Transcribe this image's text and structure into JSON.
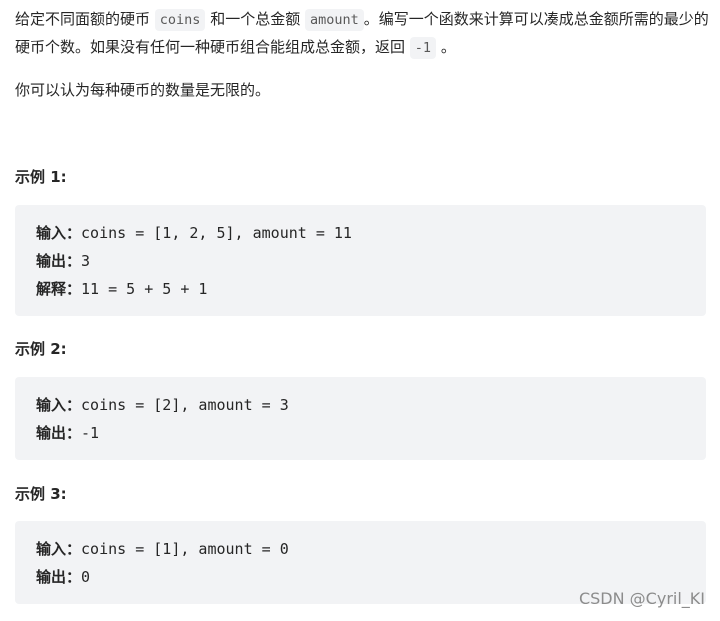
{
  "intro": {
    "t1": "给定不同面额的硬币 ",
    "c1": "coins",
    "t2": " 和一个总金额 ",
    "c2": "amount",
    "t3": "。编写一个函数来计算可以凑成总金额所需的最少的硬币个数。如果没有任何一种硬币组合能组成总金额，返回 ",
    "c3": "-1",
    "t4": " 。"
  },
  "note": "你可以认为每种硬币的数量是无限的。",
  "examples": [
    {
      "title": "示例 1:",
      "lines": [
        {
          "label": "输入：",
          "value": "coins = [1, 2, 5], amount = 11"
        },
        {
          "label": "输出：",
          "value": "3"
        },
        {
          "label": "解释：",
          "value": "11 = 5 + 5 + 1"
        }
      ]
    },
    {
      "title": "示例 2:",
      "lines": [
        {
          "label": "输入：",
          "value": "coins = [2], amount = 3"
        },
        {
          "label": "输出：",
          "value": "-1"
        }
      ]
    },
    {
      "title": "示例 3:",
      "lines": [
        {
          "label": "输入：",
          "value": "coins = [1], amount = 0"
        },
        {
          "label": "输出：",
          "value": "0"
        }
      ]
    }
  ],
  "watermark": "CSDN @Cyril_KI"
}
